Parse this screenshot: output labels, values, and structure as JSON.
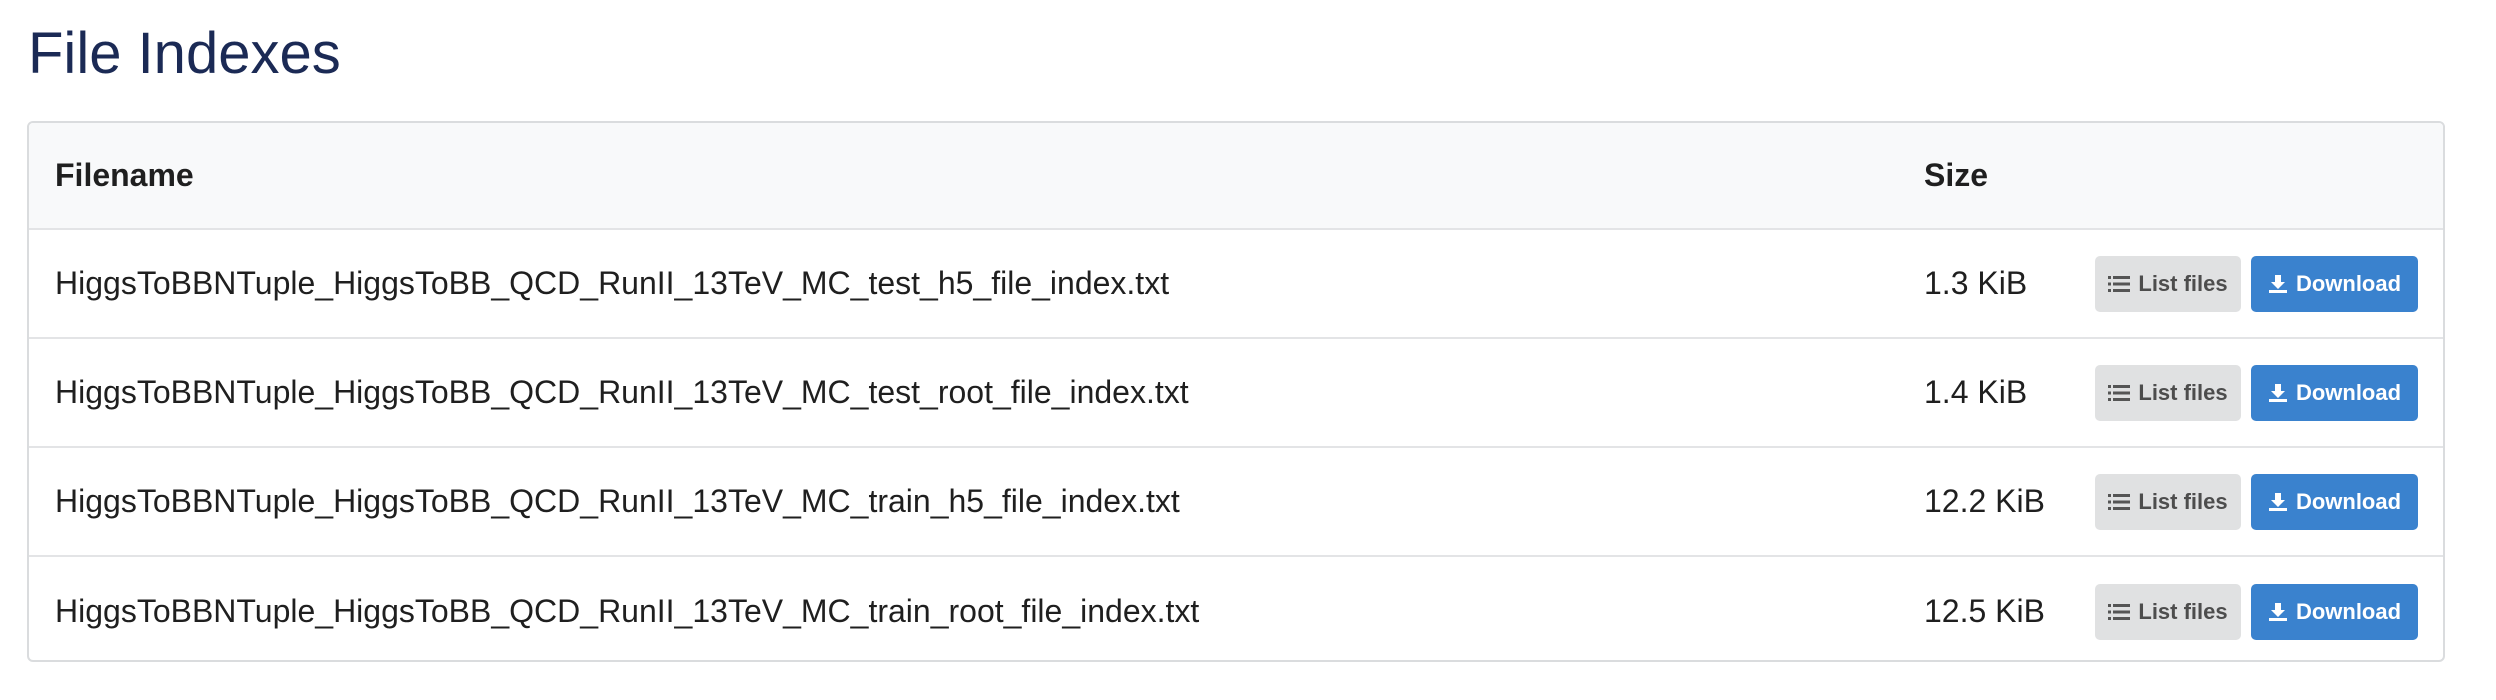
{
  "section_title": "File Indexes",
  "table": {
    "headers": {
      "filename": "Filename",
      "size": "Size"
    },
    "rows": [
      {
        "filename": "HiggsToBBNTuple_HiggsToBB_QCD_RunII_13TeV_MC_test_h5_file_index.txt",
        "size": "1.3 KiB",
        "list_label": "List files",
        "download_label": "Download"
      },
      {
        "filename": "HiggsToBBNTuple_HiggsToBB_QCD_RunII_13TeV_MC_test_root_file_index.txt",
        "size": "1.4 KiB",
        "list_label": "List files",
        "download_label": "Download"
      },
      {
        "filename": "HiggsToBBNTuple_HiggsToBB_QCD_RunII_13TeV_MC_train_h5_file_index.txt",
        "size": "12.2 KiB",
        "list_label": "List files",
        "download_label": "Download"
      },
      {
        "filename": "HiggsToBBNTuple_HiggsToBB_QCD_RunII_13TeV_MC_train_root_file_index.txt",
        "size": "12.5 KiB",
        "list_label": "List files",
        "download_label": "Download"
      }
    ]
  },
  "icons": {
    "list": "list-icon",
    "download": "download-icon"
  },
  "colors": {
    "title": "#1b2a55",
    "download_button": "#3a82ce",
    "list_button": "#e0e1e2",
    "header_background": "#f8f9fa"
  }
}
